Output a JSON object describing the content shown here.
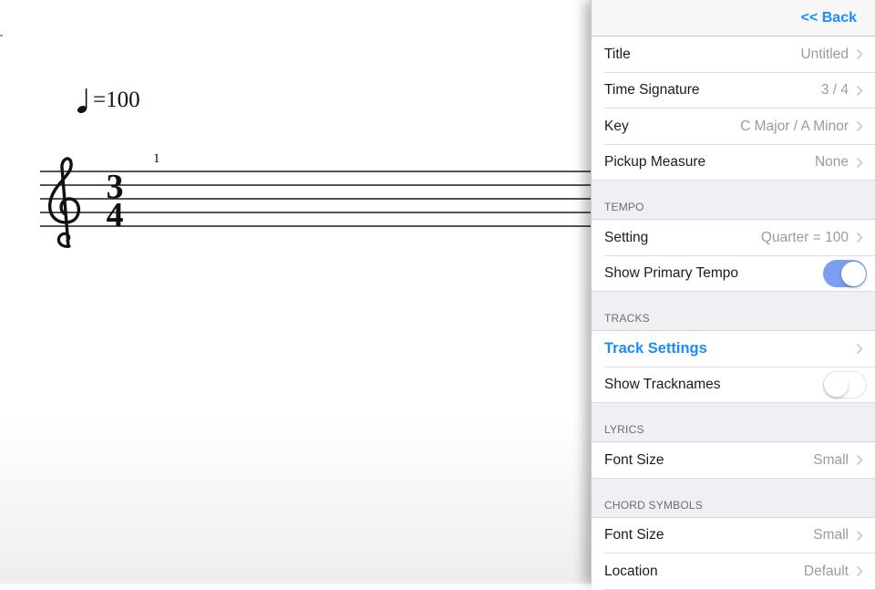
{
  "score": {
    "tempo_text": "=100",
    "measure_number": "1",
    "time_signature": {
      "top": "3",
      "bottom": "4"
    }
  },
  "panel": {
    "back_label": "<< Back",
    "general": [
      {
        "label": "Title",
        "value": "Untitled"
      },
      {
        "label": "Time Signature",
        "value": "3 / 4"
      },
      {
        "label": "Key",
        "value": "C Major / A Minor"
      },
      {
        "label": "Pickup Measure",
        "value": "None"
      }
    ],
    "tempo": {
      "header": "TEMPO",
      "setting_label": "Setting",
      "setting_value": "Quarter = 100",
      "show_primary_label": "Show Primary Tempo",
      "show_primary_on": true
    },
    "tracks": {
      "header": "TRACKS",
      "track_settings_label": "Track Settings",
      "show_tracknames_label": "Show Tracknames",
      "show_tracknames_on": false
    },
    "lyrics": {
      "header": "LYRICS",
      "font_size_label": "Font Size",
      "font_size_value": "Small"
    },
    "chord_symbols": {
      "header": "CHORD SYMBOLS",
      "font_size_label": "Font Size",
      "font_size_value": "Small",
      "location_label": "Location",
      "location_value": "Default"
    }
  },
  "colors": {
    "accent": "#1a8cff",
    "toggle_on": "#7a9ef0",
    "panel_bg": "#efeff4",
    "value_gray": "#9b9b9b"
  }
}
